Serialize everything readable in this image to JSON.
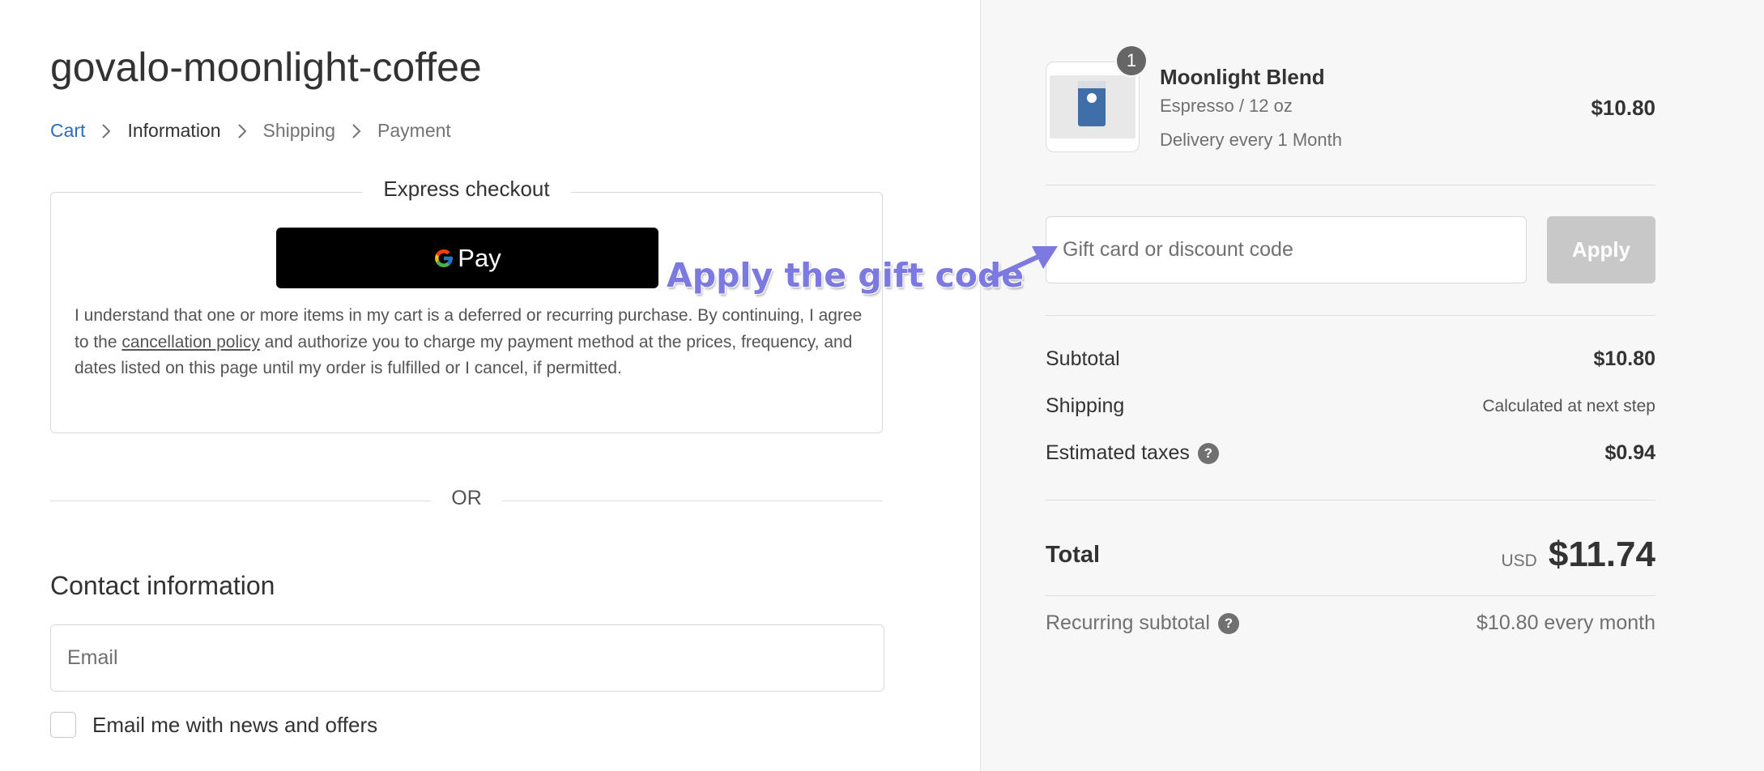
{
  "store": {
    "title": "govalo-moonlight-coffee"
  },
  "breadcrumb": {
    "items": [
      {
        "label": "Cart"
      },
      {
        "label": "Information"
      },
      {
        "label": "Shipping"
      },
      {
        "label": "Payment"
      }
    ]
  },
  "express": {
    "title": "Express checkout",
    "gpay_label": "Pay",
    "disclaimer_before": "I understand that one or more items in my cart is a deferred or recurring purchase. By continuing, I agree to the ",
    "disclaimer_link": "cancellation policy",
    "disclaimer_after": " and authorize you to charge my payment method at the prices, frequency, and dates listed on this page until my order is fulfilled or I cancel, if permitted."
  },
  "divider_text": "OR",
  "contact": {
    "title": "Contact information",
    "email_placeholder": "Email",
    "newsletter_label": "Email me with news and offers"
  },
  "annotation": {
    "text": "Apply the gift code",
    "color": "#7c7ae0"
  },
  "order": {
    "product": {
      "quantity": "1",
      "name": "Moonlight Blend",
      "variant": "Espresso / 12 oz",
      "delivery": "Delivery every 1 Month",
      "price": "$10.80"
    },
    "discount": {
      "placeholder": "Gift card or discount code",
      "apply_label": "Apply"
    },
    "subtotal": {
      "label": "Subtotal",
      "value": "$10.80"
    },
    "shipping": {
      "label": "Shipping",
      "value": "Calculated at next step"
    },
    "taxes": {
      "label": "Estimated taxes",
      "value": "$0.94"
    },
    "total": {
      "label": "Total",
      "currency": "USD",
      "value": "$11.74"
    },
    "recurring": {
      "label": "Recurring subtotal",
      "value": "$10.80 every month"
    }
  },
  "colors": {
    "link": "#2a6ebb",
    "sidebar_bg": "#f7f7f7",
    "apply_disabled": "#c8c8c8"
  }
}
